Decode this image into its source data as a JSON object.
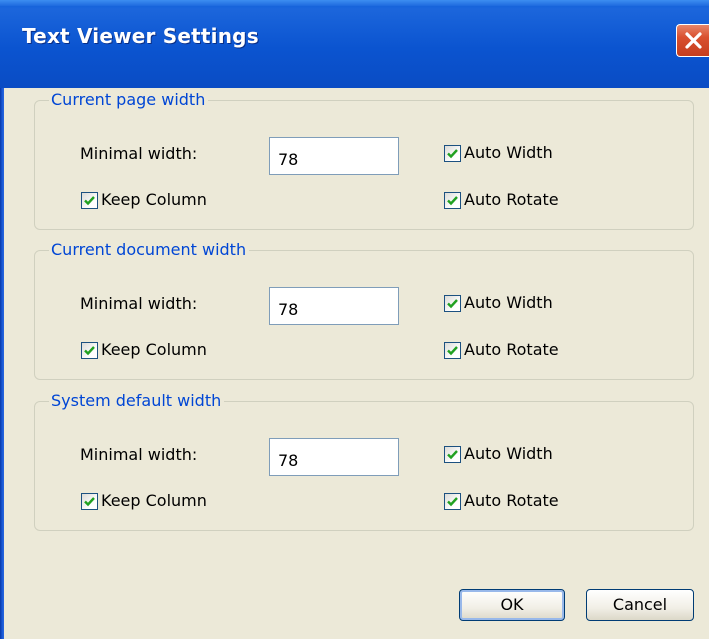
{
  "window": {
    "title": "Text Viewer Settings"
  },
  "groups": [
    {
      "legend": "Current page width",
      "minimal_width_label": "Minimal width:",
      "minimal_width_value": "78",
      "keep_column_label": "Keep Column",
      "keep_column_checked": true,
      "auto_width_label": "Auto Width",
      "auto_width_checked": true,
      "auto_rotate_label": "Auto Rotate",
      "auto_rotate_checked": true
    },
    {
      "legend": "Current document width",
      "minimal_width_label": "Minimal width:",
      "minimal_width_value": "78",
      "keep_column_label": "Keep Column",
      "keep_column_checked": true,
      "auto_width_label": "Auto Width",
      "auto_width_checked": true,
      "auto_rotate_label": "Auto Rotate",
      "auto_rotate_checked": true
    },
    {
      "legend": "System default width",
      "minimal_width_label": "Minimal width:",
      "minimal_width_value": "78",
      "keep_column_label": "Keep Column",
      "keep_column_checked": true,
      "auto_width_label": "Auto Width",
      "auto_width_checked": true,
      "auto_rotate_label": "Auto Rotate",
      "auto_rotate_checked": true
    }
  ],
  "buttons": {
    "ok_label": "OK",
    "cancel_label": "Cancel"
  },
  "icons": {
    "close": "close-icon",
    "check": "checkmark-icon"
  },
  "colors": {
    "title_bar": "#0b54d0",
    "dialog_face": "#ece9d8",
    "group_legend": "#0046d5",
    "checkmark": "#21a121",
    "close_button": "#d9502f"
  }
}
